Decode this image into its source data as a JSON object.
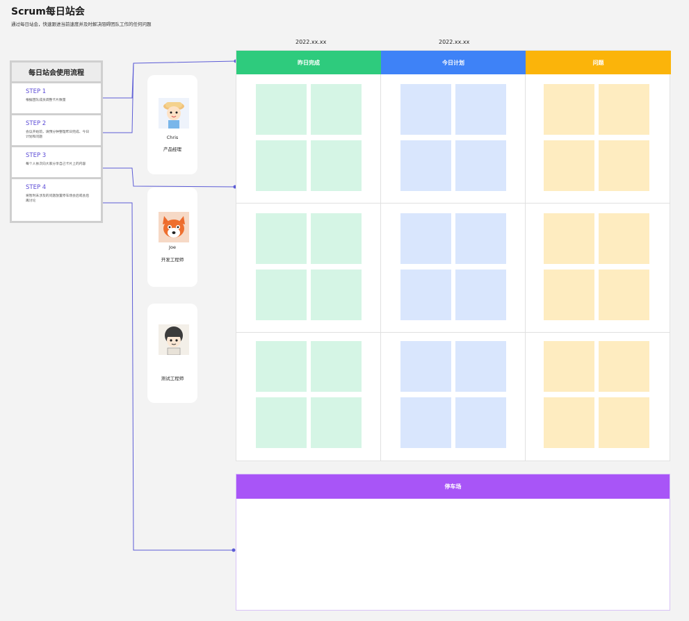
{
  "page": {
    "title": "Scrum每日站会",
    "subtitle": "通过每日站会，快速跟进当前速度并及时解决阻碍团队工作的任何问题"
  },
  "dates": [
    "2022.xx.xx",
    "2022.xx.xx"
  ],
  "process": {
    "title": "每日站会使用流程",
    "steps": [
      {
        "label": "STEP 1",
        "desc": "根据团队成员调整卡片数量"
      },
      {
        "label": "STEP 2",
        "desc": "会议开始前，请预分钟整理昨日完成、今日计划和问题"
      },
      {
        "label": "STEP 3",
        "desc": "每个人依次向大家分享自己卡片上的内容"
      },
      {
        "label": "STEP 4",
        "desc": "将暂时未涉及的问题放置停车场会后或会后再讨论"
      }
    ]
  },
  "roles": [
    {
      "name": "Chris",
      "title": "产品经理",
      "avatar": "boy-with-hat-avatar"
    },
    {
      "name": "Joe",
      "title": "开发工程师",
      "avatar": "red-fox-avatar"
    },
    {
      "name": "",
      "title": "测试工程师",
      "avatar": "curly-hair-kid-avatar"
    }
  ],
  "board": {
    "columns": [
      {
        "label": "昨日完成",
        "color": "#2ecb7d",
        "note_color": "#d5f5e5"
      },
      {
        "label": "今日计划",
        "color": "#3e82f7",
        "note_color": "#d9e6fd"
      },
      {
        "label": "问题",
        "color": "#fbb40a",
        "note_color": "#feecc0"
      }
    ],
    "rows": 3,
    "notes_per_cell": 4
  },
  "parking_lot": {
    "label": "停车场",
    "color": "#a855f7"
  },
  "connector_color": "#5b5bd6"
}
